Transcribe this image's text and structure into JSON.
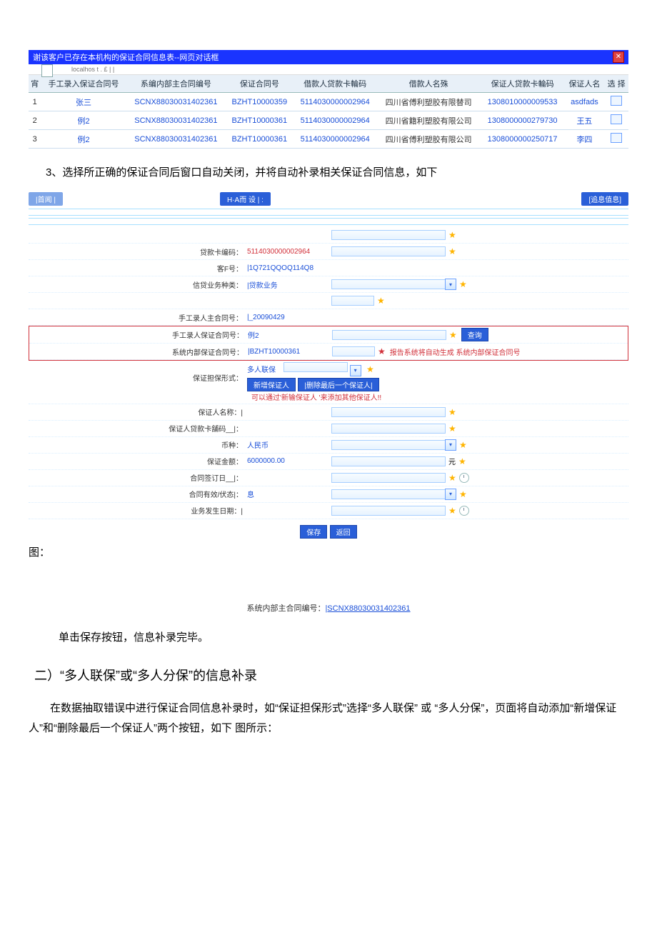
{
  "dialog": {
    "title": "谢该客户已存在本机构的保证合同信息表--网页对话框",
    "url_hint": "localhos t . £ | |",
    "close_glyph": "✕",
    "columns": [
      "宵",
      "手工录入保证合同号",
      "系编内部主合同编号",
      "保证合同号",
      "借款人贷款卡輪码",
      "借款人名殊",
      "保证人贷款卡輪码",
      "保证人名",
      "选 择"
    ],
    "rows": [
      {
        "idx": "1",
        "manual": "张三",
        "main": "SCNX88030031402361",
        "contract": "BZHT10000359",
        "card": "5114030000002964",
        "borrower": "四川省傅利塑胶有限替司",
        "guar_card": "1308010000009533",
        "guar_name": "asdfads"
      },
      {
        "idx": "2",
        "manual": "例2",
        "main": "SCNX88030031402361",
        "contract": "BZHT10000361",
        "card": "5114030000002964",
        "borrower": "四川省籍利塑胶有限公司",
        "guar_card": "1308000000279730",
        "guar_name": "王五"
      },
      {
        "idx": "3",
        "manual": "例2",
        "main": "SCNX88030031402361",
        "contract": "BZHT10000361",
        "card": "5114030000002964",
        "borrower": "四川省傅利塑胶有限公司",
        "guar_card": "1308000000250717",
        "guar_name": "李四"
      }
    ]
  },
  "text": {
    "step3": "3、选择所正确的保证合同后窗口自动关闭，并将自动补录相关保证合同信息，如下",
    "caption_fig": "图：",
    "supp_label": "系统内部主合同编号：",
    "supp_value": "|SCNX88030031402361",
    "after_save": "单击保存按钮，信息补录完毕。",
    "section2": "二）“多人联保”或“多人分保”的信息补录",
    "para": "在数据抽取错误中进行保证合同信息补录时，如“保证担保形式”选择“多人联保” 或 “多人分保”，页面将自动添加“新增保证人”和“删除最后一个保证人”两个按钮，如下 图所示："
  },
  "form": {
    "tab_left": "|首闻 |",
    "tab_mid": "H·A而 设 | :",
    "tab_right": "[追息值息]",
    "rows": {
      "loan_card_lab": "贷款卡编码：",
      "loan_card_val": "5114030000002964",
      "cust_lab": "客F号：",
      "cust_val": "|1Q721QQOQ114Q8",
      "biz_lab": "信贷业务种类：",
      "biz_val": "|贷款业务",
      "manual_main_lab": "手工录人主合同号：",
      "manual_main_val": "|_20090429",
      "manual_guar_lab": "手工录人保证合同号：",
      "manual_guar_val": "例2",
      "query_btn": "查询",
      "sys_guar_lab": "系统内部保证合同号：",
      "sys_guar_val": "|BZHT10000361",
      "sys_guar_hint": "报告系统将自动生成 系统内部保证合同号",
      "form_type_lab": "保证担保形式：",
      "form_type_val": "多人联保",
      "add_btn": "新增保证人",
      "del_btn": "|删除最后一个保证人|",
      "form_type_hint": "可以通过'新输保证人 '来添加其他保证人!!",
      "guar_name_lab": "保证人名称：|",
      "guar_card_lab": "保证人贷款卡舗码__|：",
      "currency_lab": "币种：",
      "currency_val": "人民币",
      "amount_lab": "保证金额：",
      "amount_val": "6000000.00",
      "amount_unit": "元",
      "sign_date_lab": "合同签订日__|：",
      "valid_lab": "合同有效/伏态|：",
      "valid_val": "息",
      "biz_date_lab": "业务发生日期：|",
      "save": "保存",
      "back": "返回"
    }
  }
}
